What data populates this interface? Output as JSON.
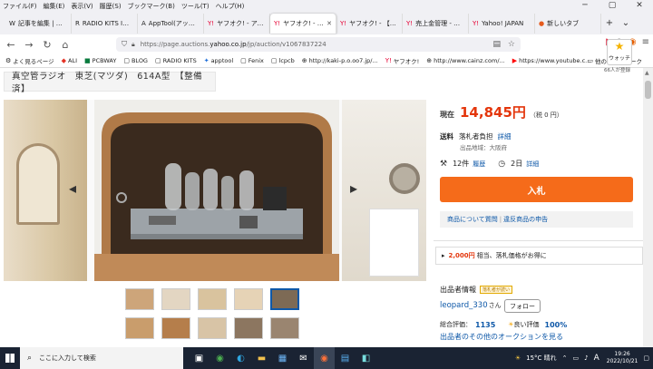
{
  "menu": [
    "ファイル(F)",
    "編集(E)",
    "表示(V)",
    "履歴(S)",
    "ブックマーク(B)",
    "ツール(T)",
    "ヘルプ(H)"
  ],
  "tabs": [
    {
      "icon": "W",
      "title": "記事を編集 | 作成",
      "active": false
    },
    {
      "icon": "R",
      "title": "RADIO KITS IN JA",
      "active": false
    },
    {
      "icon": "A",
      "title": "AppTool(アップツ",
      "active": false
    },
    {
      "icon": "Y!",
      "title": "ヤフオク! - アンティ",
      "active": false
    },
    {
      "icon": "Y!",
      "title": "ヤフオク! - 真空管",
      "active": true
    },
    {
      "icon": "Y!",
      "title": "ヤフオク! - 【レスト",
      "active": false
    },
    {
      "icon": "Y!",
      "title": "売上金管理 - ヤフ",
      "active": false
    },
    {
      "icon": "Y!",
      "title": "Yahoo! JAPAN",
      "active": false
    },
    {
      "icon": "●",
      "title": "新しいタブ",
      "active": false
    }
  ],
  "url": {
    "prefix": "https://page.auctions.",
    "domain": "yahoo.co.jp",
    "path": "/jp/auction/v1067837224"
  },
  "bookmarks": [
    "よく見るページ",
    "ALI",
    "PCBWAY",
    "BLOG",
    "RADIO KITS",
    "apptool",
    "Fenix",
    "lcpcb",
    "http://kaki-p.o.oo7.jp/...",
    "ヤフオク!",
    "http://www.cainz.com/...",
    "https://www.youtube.c..."
  ],
  "bookmarks_other": "他のブックマーク",
  "title": "真空管ラジオ　東芝(マツダ)　614A型　【整備済】",
  "price": {
    "label": "現在",
    "value": "14,845円",
    "tax": "（税 0 円）"
  },
  "watch": {
    "label": "ウォッチ",
    "count": "66人が登録"
  },
  "shipping": {
    "label": "送料",
    "value": "落札者負担",
    "link": "詳細",
    "origin": "出品地域：大阪府"
  },
  "bids": {
    "count": "12件",
    "history": "履歴",
    "time": "2日",
    "detail": "詳細"
  },
  "bid_button": "入札",
  "links": {
    "question": "商品について質問",
    "report": "違反商品の申告"
  },
  "promo": {
    "amount": "2,000円",
    "text": "相当、落札価格がお得に"
  },
  "seller": {
    "header": "出品者情報",
    "badge": "落札者が読い",
    "name": "leopard_330",
    "suffix": "さん",
    "follow": "フォロー"
  },
  "rating": {
    "total_label": "総合評価：",
    "total": "1135",
    "good_label": "良い評価",
    "percent": "100%"
  },
  "other_auctions": "出品者のその他のオークションを見る",
  "taskbar": {
    "search": "ここに入力して検索",
    "weather": "15°C  晴れ",
    "time": "19:26",
    "date": "2022/10/21",
    "ime": "A"
  }
}
